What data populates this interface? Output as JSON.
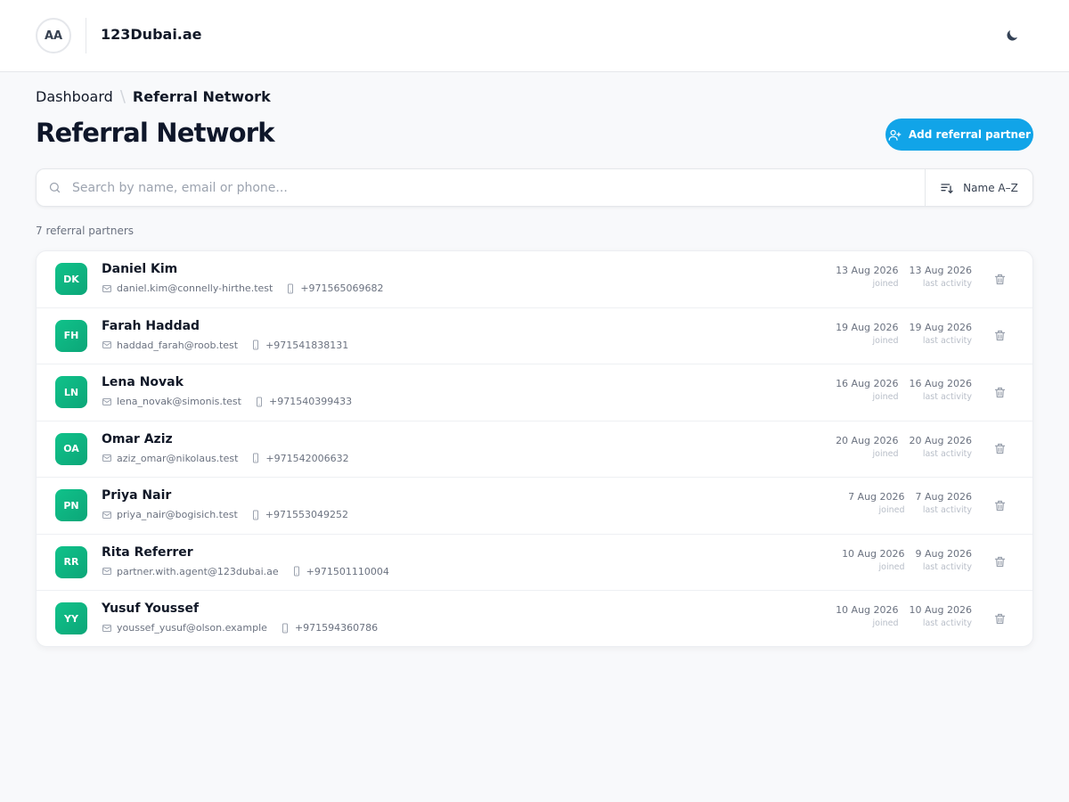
{
  "header": {
    "avatar_initials": "AA",
    "app_title": "123Dubai.ae"
  },
  "breadcrumb": {
    "parent": "Dashboard",
    "current": "Referral Network"
  },
  "page": {
    "title": "Referral Network",
    "add_button_label": "Add referral partner"
  },
  "search": {
    "placeholder": "Search by name, email or phone...",
    "value": ""
  },
  "sort": {
    "label": "Name A–Z"
  },
  "summary": {
    "count_text": "7 referral partners"
  },
  "labels": {
    "joined": "joined",
    "last_activity": "last activity"
  },
  "colors": {
    "accent": "#11a4e8",
    "avatar_green": "#10c28a"
  },
  "partners": [
    {
      "initials": "DK",
      "name": "Daniel Kim",
      "email": "daniel.kim@connelly-hirthe.test",
      "phone": "+971565069682",
      "joined": "13 Aug 2026",
      "last_activity": "13 Aug 2026"
    },
    {
      "initials": "FH",
      "name": "Farah Haddad",
      "email": "haddad_farah@roob.test",
      "phone": "+971541838131",
      "joined": "19 Aug 2026",
      "last_activity": "19 Aug 2026"
    },
    {
      "initials": "LN",
      "name": "Lena Novak",
      "email": "lena_novak@simonis.test",
      "phone": "+971540399433",
      "joined": "16 Aug 2026",
      "last_activity": "16 Aug 2026"
    },
    {
      "initials": "OA",
      "name": "Omar Aziz",
      "email": "aziz_omar@nikolaus.test",
      "phone": "+971542006632",
      "joined": "20 Aug 2026",
      "last_activity": "20 Aug 2026"
    },
    {
      "initials": "PN",
      "name": "Priya Nair",
      "email": "priya_nair@bogisich.test",
      "phone": "+971553049252",
      "joined": "7 Aug 2026",
      "last_activity": "7 Aug 2026"
    },
    {
      "initials": "RR",
      "name": "Rita Referrer",
      "email": "partner.with.agent@123dubai.ae",
      "phone": "+971501110004",
      "joined": "10 Aug 2026",
      "last_activity": "9 Aug 2026"
    },
    {
      "initials": "YY",
      "name": "Yusuf Youssef",
      "email": "youssef_yusuf@olson.example",
      "phone": "+971594360786",
      "joined": "10 Aug 2026",
      "last_activity": "10 Aug 2026"
    }
  ]
}
